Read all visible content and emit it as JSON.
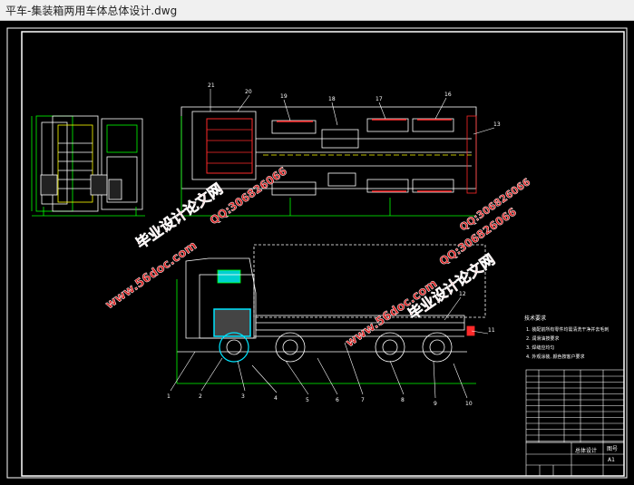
{
  "window": {
    "title": "平车-集装箱两用车体总体设计.dwg"
  },
  "drawing": {
    "part_numbers": [
      "1",
      "2",
      "3",
      "4",
      "5",
      "6",
      "7",
      "8",
      "9",
      "10",
      "11",
      "12",
      "13",
      "16",
      "17",
      "18",
      "19",
      "20",
      "21"
    ],
    "watermarks": [
      {
        "text": "毕业设计论文网"
      },
      {
        "text": "QQ:306826066"
      },
      {
        "text": "www.56doc.com"
      },
      {
        "text": "www.56doc.com"
      },
      {
        "text": "QQ:306826066"
      },
      {
        "text": "毕业设计论文网"
      },
      {
        "text": "QQ:306826066"
      }
    ],
    "tech_notes_title": "技术要求",
    "tech_notes": [
      "1. 装配前所有零件均需清洗干净并去毛刺",
      "2. 润滑油按要求",
      "3. 焊缝应均匀",
      "4. 外观涂装, 颜色按客户要求"
    ],
    "title_block": {
      "name": "总体设计",
      "sheet": "A1",
      "doc_no": "图号"
    }
  },
  "colors": {
    "bg": "#000000",
    "line": "#ffffff",
    "green": "#00ff00",
    "yellow": "#ffff00",
    "red": "#ff2a2a",
    "cyan": "#00e5ff",
    "watermark": "#d81b1b"
  }
}
